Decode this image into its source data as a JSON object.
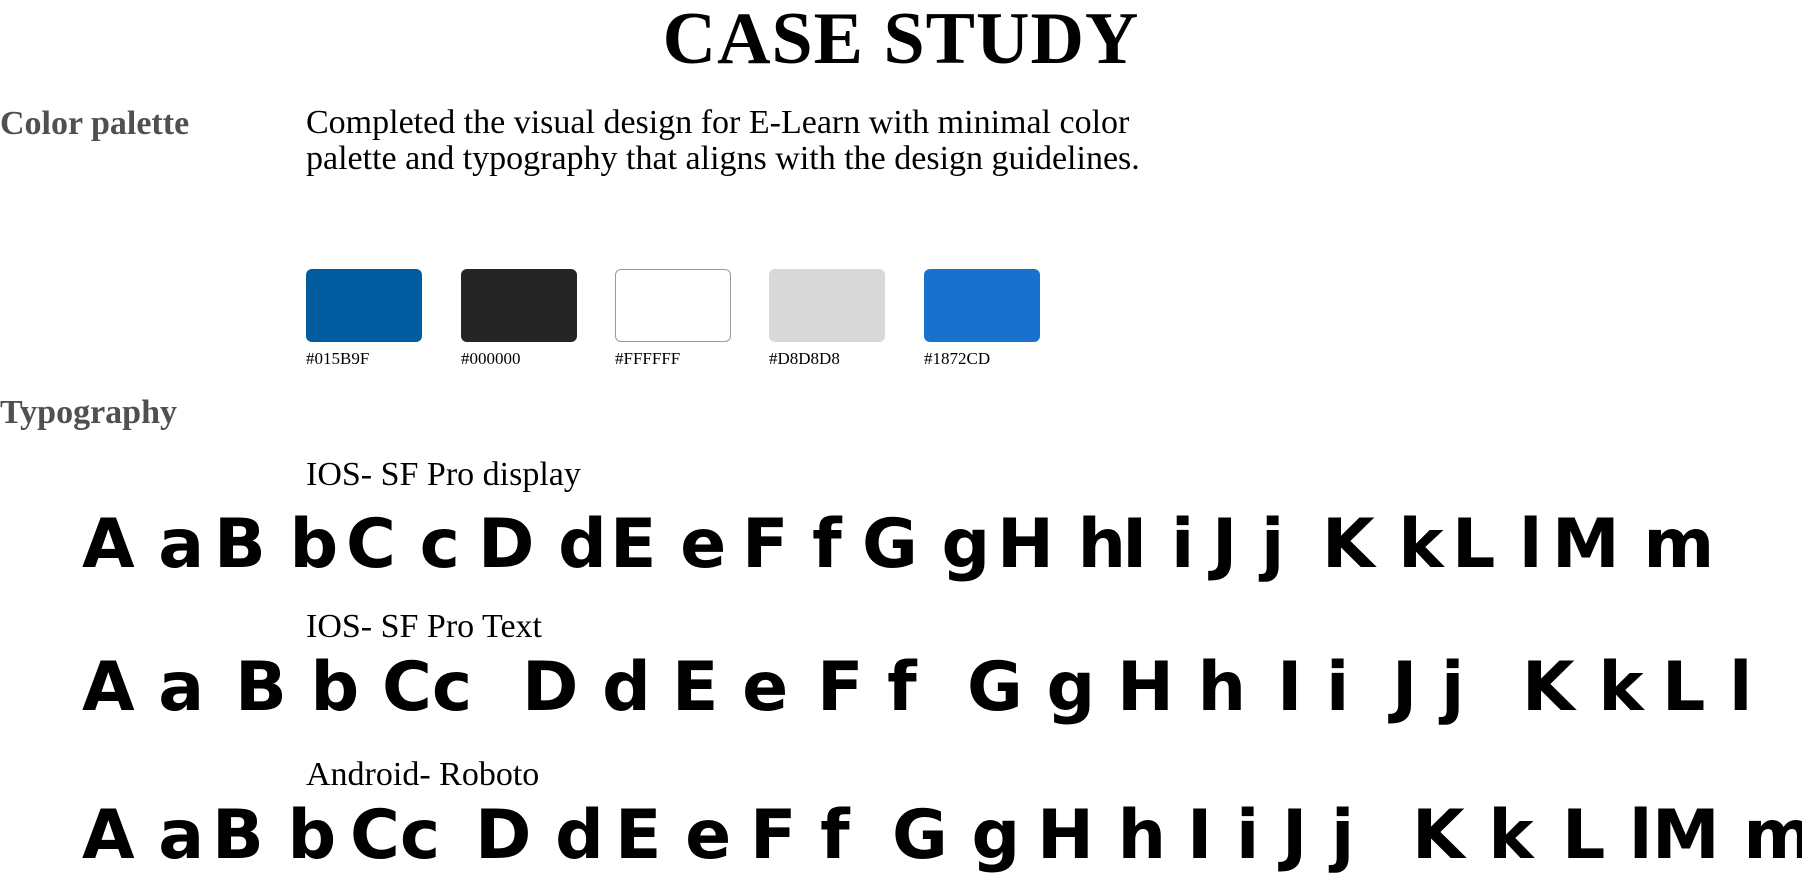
{
  "page": {
    "title": "CASE STUDY"
  },
  "color_section": {
    "heading": "Color palette",
    "description": "Completed the visual design for E-Learn with minimal color palette and typography that aligns with the design guidelines.",
    "swatches": [
      {
        "label": "#015B9F",
        "color": "#015B9F"
      },
      {
        "label": "#000000",
        "color": "#252525"
      },
      {
        "label": "#FFFFFF",
        "color": "#FFFFFF"
      },
      {
        "label": "#D8D8D8",
        "color": "#D8D8D8"
      },
      {
        "label": "#1872CD",
        "color": "#1872CD"
      }
    ]
  },
  "typography_section": {
    "heading": "Typography",
    "fonts": [
      {
        "label": "IOS- SF Pro display",
        "glyph_pairs": [
          "A a",
          "B b",
          "C c",
          "D d",
          "E e",
          "F f",
          "G g",
          "H h",
          "I i",
          "J j",
          "K k",
          "L l",
          "M m"
        ]
      },
      {
        "label": "IOS- SF Pro Text",
        "glyph_pairs": [
          "A a",
          "B b",
          "Cc",
          "D d",
          "E e",
          "F f",
          "G g",
          "H h",
          "I i",
          "J j",
          "K k",
          "L l"
        ]
      },
      {
        "label": "Android- Roboto",
        "glyph_pairs": [
          "A a",
          "B b",
          "Cc",
          "D d",
          "E e",
          "F f",
          "G g",
          "H h",
          "I i",
          "J j",
          "K k",
          "L l",
          "M m"
        ]
      }
    ]
  }
}
